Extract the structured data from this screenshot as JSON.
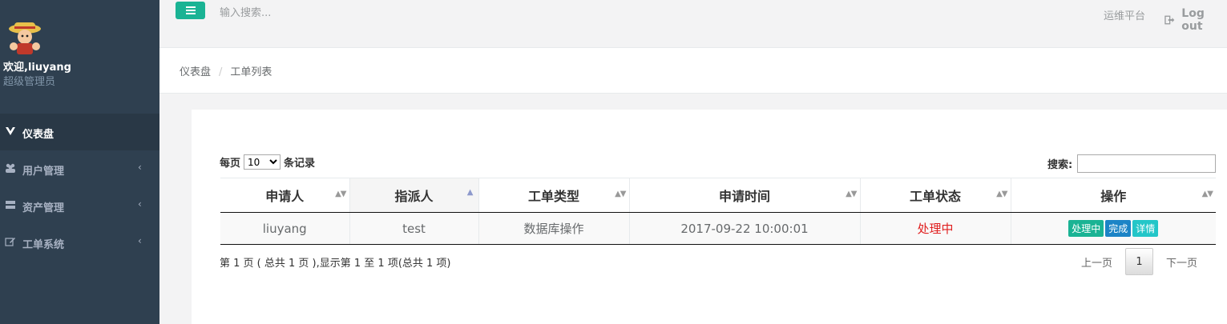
{
  "profile": {
    "welcome": "欢迎,liuyang",
    "role": "超级管理员",
    "avatar_icon": "luffy-avatar-icon"
  },
  "nav": [
    {
      "label": "仪表盘",
      "icon": "dashboard-icon",
      "active": true
    },
    {
      "label": "用户管理",
      "icon": "users-icon",
      "chevron": "‹"
    },
    {
      "label": "资产管理",
      "icon": "server-icon",
      "chevron": "‹"
    },
    {
      "label": "工单系统",
      "icon": "edit-icon",
      "chevron": "‹"
    }
  ],
  "topbar": {
    "search_placeholder": "输入搜索...",
    "ops_link": "运维平台",
    "logout": "Log out"
  },
  "breadcrumb": {
    "home": "仪表盘",
    "sep": "/",
    "current": "工单列表"
  },
  "table_controls": {
    "length_prefix": "每页",
    "length_value": "10",
    "length_suffix": "条记录",
    "search_label": "搜索:"
  },
  "table": {
    "headers": [
      "申请人",
      "指派人",
      "工单类型",
      "申请时间",
      "工单状态",
      "操作"
    ],
    "rows": [
      {
        "applicant": "liuyang",
        "assignee": "test",
        "type": "数据库操作",
        "time": "2017-09-22 10:00:01",
        "status": "处理中",
        "actions": [
          "处理中",
          "完成",
          "详情"
        ]
      }
    ]
  },
  "footer": {
    "info": "第 1 页 ( 总共 1 页 ),显示第 1 至 1 项(总共 1 项)",
    "prev": "上一页",
    "page": "1",
    "next": "下一页"
  },
  "colors": {
    "sidebar": "#2f4050",
    "primary": "#1ab394",
    "blue": "#1c84c6",
    "cyan": "#23c6c8",
    "danger": "#e02020"
  }
}
